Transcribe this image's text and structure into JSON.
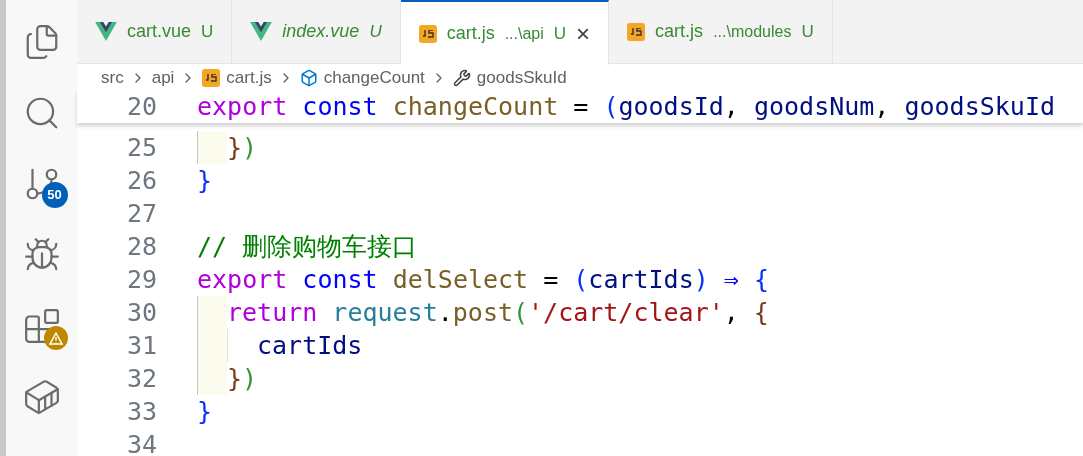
{
  "activity_bar": [
    {
      "kind": "files",
      "selected": false
    },
    {
      "kind": "search",
      "selected": false
    },
    {
      "kind": "scm",
      "selected": false,
      "badge": "50"
    },
    {
      "kind": "debug",
      "selected": false
    },
    {
      "kind": "extensions",
      "selected": false,
      "warning": true
    },
    {
      "kind": "docker",
      "selected": false
    }
  ],
  "tabs": [
    {
      "kind": "vue",
      "label": "cart.vue",
      "status": "U",
      "preview": false,
      "selected": false
    },
    {
      "kind": "vue",
      "label": "index.vue",
      "status": "U",
      "preview": true,
      "selected": false
    },
    {
      "kind": "js",
      "label": "cart.js",
      "description": "...\\api",
      "status": "U",
      "preview": false,
      "selected": true,
      "close": "×"
    },
    {
      "kind": "js",
      "label": "cart.js",
      "description": "...\\modules",
      "status": "U",
      "preview": false,
      "selected": false
    }
  ],
  "breadcrumb": [
    {
      "kind": "folder",
      "label": "src"
    },
    {
      "kind": "folder",
      "label": "api"
    },
    {
      "kind": "js-file",
      "label": "cart.js"
    },
    {
      "kind": "variable",
      "label": "changeCount"
    },
    {
      "kind": "property",
      "label": "goodsSkuId"
    }
  ],
  "sticky_line": {
    "number": "20",
    "tokens": [
      {
        "kind": "keyword",
        "text": "export "
      },
      {
        "kind": "storage",
        "text": "const "
      },
      {
        "kind": "function",
        "text": "changeCount"
      },
      {
        "kind": "plain",
        "text": " = "
      },
      {
        "kind": "bracket1",
        "text": "("
      },
      {
        "kind": "param",
        "text": "goodsId"
      },
      {
        "kind": "plain",
        "text": ", "
      },
      {
        "kind": "param",
        "text": "goodsNum"
      },
      {
        "kind": "plain",
        "text": ", "
      },
      {
        "kind": "param",
        "text": "goodsSkuId"
      }
    ]
  },
  "lines": [
    {
      "number": "25",
      "guides": [
        {
          "highlighted": true
        }
      ],
      "tokens": [
        {
          "kind": "bracket3",
          "text": "}"
        },
        {
          "kind": "bracket2",
          "text": ")"
        }
      ]
    },
    {
      "number": "26",
      "tokens": [
        {
          "kind": "bracket1",
          "text": "}"
        }
      ]
    },
    {
      "number": "27"
    },
    {
      "number": "28",
      "tokens": [
        {
          "kind": "comment",
          "text": "// 删除购物车接口"
        }
      ]
    },
    {
      "number": "29",
      "tokens": [
        {
          "kind": "keyword",
          "text": "export "
        },
        {
          "kind": "storage",
          "text": "const "
        },
        {
          "kind": "function",
          "text": "delSelect"
        },
        {
          "kind": "plain",
          "text": " = "
        },
        {
          "kind": "bracket1",
          "text": "("
        },
        {
          "kind": "param",
          "text": "cartIds"
        },
        {
          "kind": "bracket1",
          "text": ")"
        },
        {
          "kind": "storage",
          "text": " ⇒ "
        },
        {
          "kind": "bracket1",
          "text": "{"
        }
      ]
    },
    {
      "number": "30",
      "guides": [
        {
          "highlighted": true
        }
      ],
      "tokens": [
        {
          "kind": "keyword",
          "text": "return "
        },
        {
          "kind": "object",
          "text": "request"
        },
        {
          "kind": "plain",
          "text": "."
        },
        {
          "kind": "function",
          "text": "post"
        },
        {
          "kind": "bracket2",
          "text": "("
        },
        {
          "kind": "string",
          "text": "'/cart/clear'"
        },
        {
          "kind": "plain",
          "text": ", "
        },
        {
          "kind": "bracket3",
          "text": "{"
        }
      ]
    },
    {
      "number": "31",
      "guides": [
        {
          "highlighted": true
        },
        {
          "highlighted": false
        }
      ],
      "tokens": [
        {
          "kind": "param",
          "text": "cartIds"
        }
      ]
    },
    {
      "number": "32",
      "guides": [
        {
          "highlighted": true
        }
      ],
      "tokens": [
        {
          "kind": "bracket3",
          "text": "}"
        },
        {
          "kind": "bracket2",
          "text": ")"
        }
      ]
    },
    {
      "number": "33",
      "tokens": [
        {
          "kind": "bracket1",
          "text": "}"
        }
      ]
    },
    {
      "number": "34"
    }
  ]
}
